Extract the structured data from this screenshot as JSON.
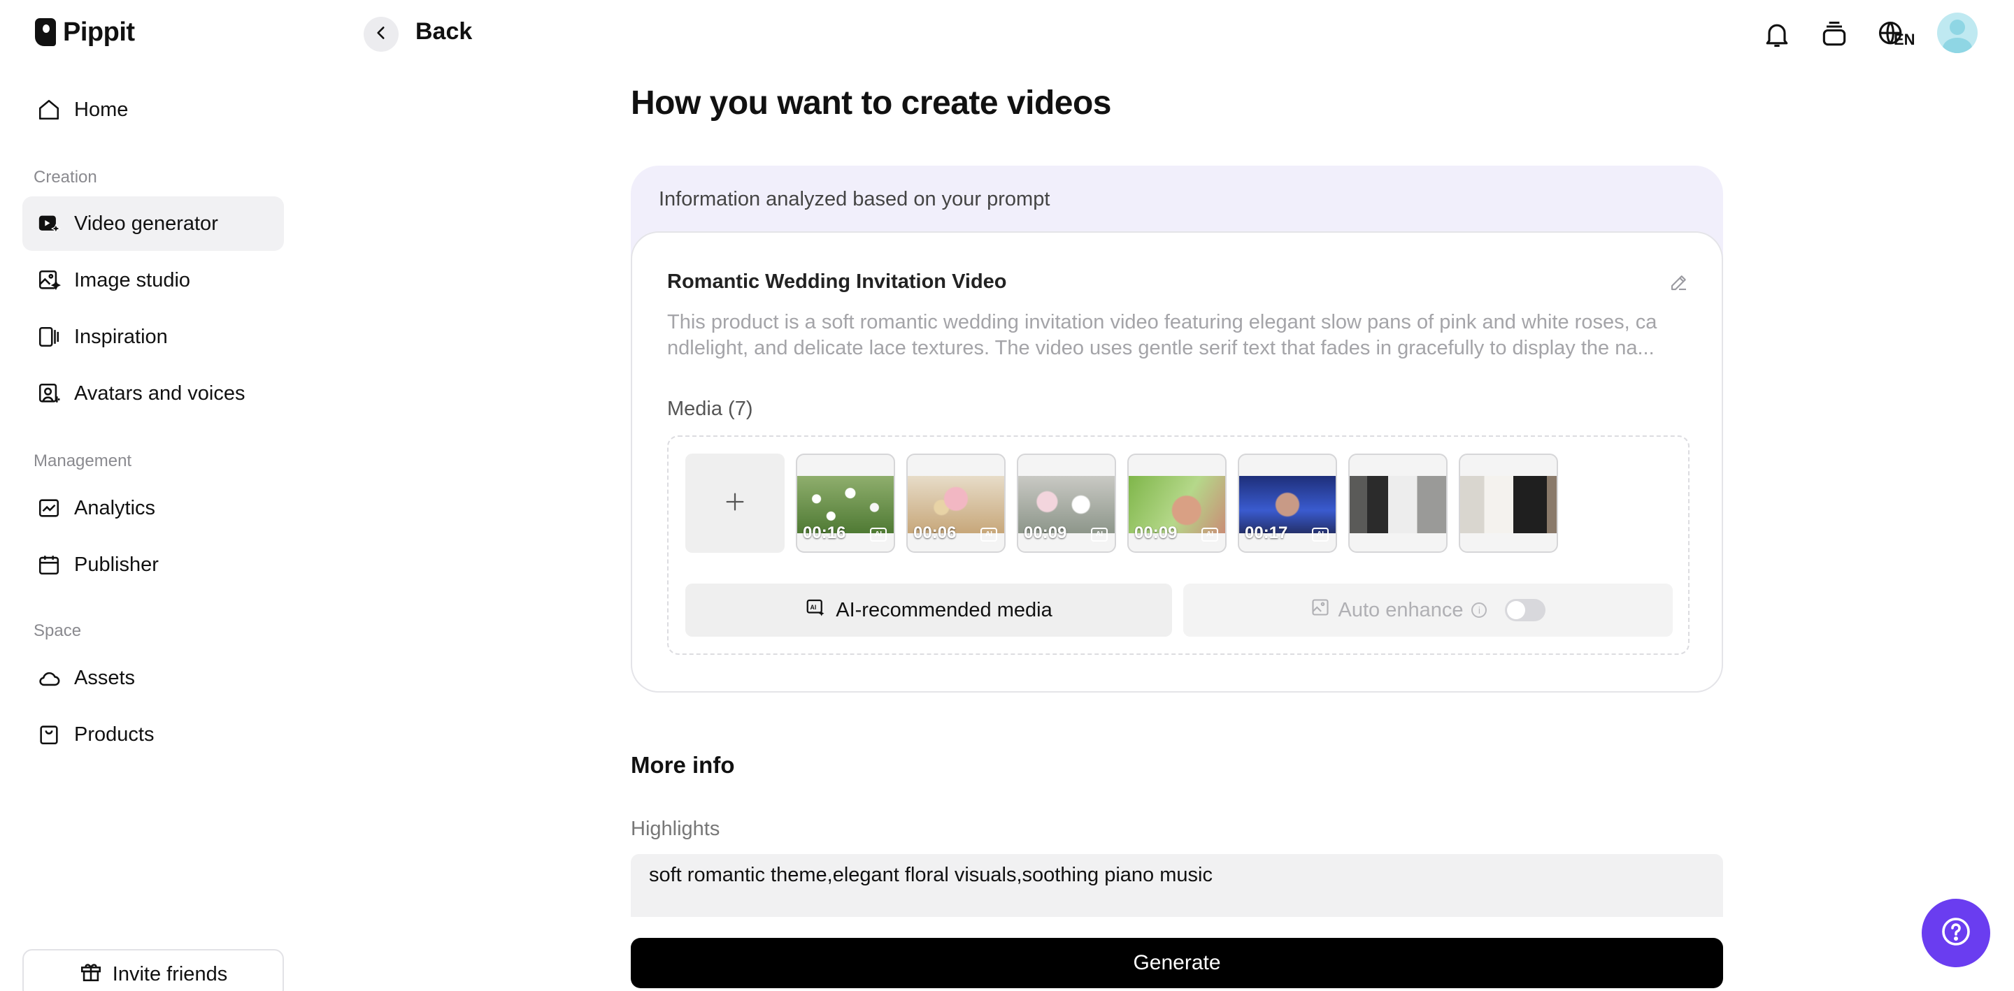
{
  "app": {
    "name": "Pippit"
  },
  "sidebar": {
    "home": "Home",
    "sections": {
      "creation": "Creation",
      "management": "Management",
      "space": "Space"
    },
    "items": [
      {
        "label": "Video generator",
        "icon": "video-generator-icon",
        "active": true
      },
      {
        "label": "Image studio",
        "icon": "image-studio-icon"
      },
      {
        "label": "Inspiration",
        "icon": "inspiration-icon"
      },
      {
        "label": "Avatars and voices",
        "icon": "avatar-voice-icon"
      },
      {
        "label": "Analytics",
        "icon": "analytics-icon"
      },
      {
        "label": "Publisher",
        "icon": "calendar-icon"
      },
      {
        "label": "Assets",
        "icon": "cloud-icon"
      },
      {
        "label": "Products",
        "icon": "bag-icon"
      }
    ],
    "invite_label": "Invite friends"
  },
  "topbar": {
    "back_label": "Back",
    "lang": "EN"
  },
  "main": {
    "title": "How you want to create videos",
    "info_header": "Information analyzed based on your prompt",
    "card_title": "Romantic Wedding Invitation Video",
    "card_desc_line1": "This product is a soft romantic wedding invitation video featuring elegant slow pans of pink and white roses, ca",
    "card_desc_line2": "ndlelight, and delicate lace textures. The video uses gentle serif text that fades in gracefully to display the na...",
    "media_label": "Media (7)",
    "media": [
      {
        "duration": "00:16",
        "ai": true
      },
      {
        "duration": "00:06",
        "ai": true
      },
      {
        "duration": "00:09",
        "ai": true
      },
      {
        "duration": "00:09",
        "ai": true
      },
      {
        "duration": "00:17",
        "ai": true
      },
      {
        "duration": "",
        "ai": false
      },
      {
        "duration": "",
        "ai": false
      }
    ],
    "ai_button": "AI-recommended media",
    "enhance_label": "Auto enhance",
    "enhance_on": false,
    "more_info": "More info",
    "highlights_label": "Highlights",
    "highlights_value": "soft romantic theme,elegant floral visuals,soothing piano music",
    "generate": "Generate"
  },
  "colors": {
    "accent": "#6a3df0",
    "info_bg": "#f1effb",
    "active_nav": "#f1f1f3"
  }
}
